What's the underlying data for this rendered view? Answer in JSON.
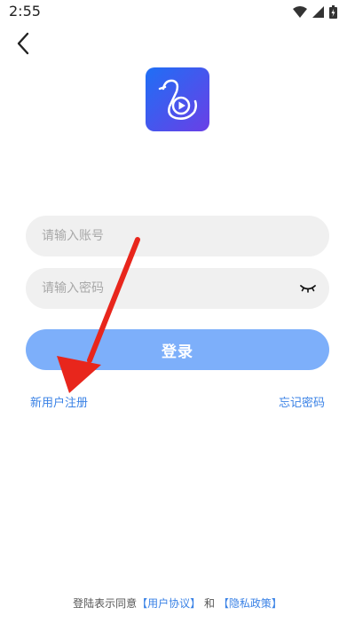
{
  "status_bar": {
    "time": "2:55",
    "icons": [
      "wifi-icon",
      "signal-icon",
      "battery-icon"
    ]
  },
  "nav": {
    "back_icon": "back-arrow-icon"
  },
  "logo": {
    "icon": "swan-play-logo",
    "gradient": [
      "#1f6ff5",
      "#6a3fe6"
    ]
  },
  "form": {
    "account_placeholder": "请输入账号",
    "account_value": "",
    "password_placeholder": "请输入密码",
    "password_value": "",
    "password_toggle_icon": "eye-closed-icon",
    "login_label": "登录",
    "register_label": "新用户注册",
    "forgot_label": "忘记密码"
  },
  "agreement": {
    "prefix": "登陆表示同意",
    "user_agreement": "【用户协议】",
    "conjunction": "和",
    "privacy_policy": "【隐私政策】"
  },
  "annotation": {
    "icon": "red-arrow-annotation",
    "color": "#e8261c"
  },
  "colors": {
    "primary_button": "#7daffa",
    "link": "#3a82e6",
    "input_bg": "#f0f0f0"
  }
}
